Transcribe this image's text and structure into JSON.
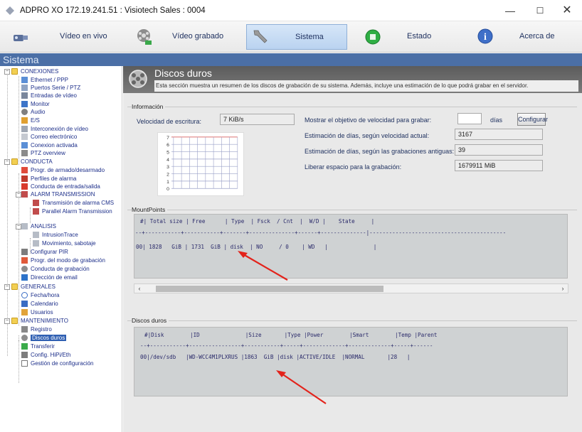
{
  "window": {
    "title": "ADPRO XO 172.19.241.51 : Visiotech Sales : 0004",
    "minimize": "—",
    "maximize": "☐",
    "close": "✕"
  },
  "toolbar": {
    "items": [
      {
        "label": "Vídeo en vivo",
        "icon": "camera-icon"
      },
      {
        "label": "Vídeo grabado",
        "icon": "film-reel-icon"
      },
      {
        "label": "Sistema",
        "icon": "wrench-icon",
        "active": true
      },
      {
        "label": "Estado",
        "icon": "status-icon"
      },
      {
        "label": "Acerca de",
        "icon": "info-icon"
      }
    ]
  },
  "sidebar": {
    "header": "Sistema",
    "items": [
      {
        "label": "CONEXIONES",
        "type": "folder"
      },
      {
        "label": "Ethernet / PPP"
      },
      {
        "label": "Puertos Serie / PTZ"
      },
      {
        "label": "Entradas de vídeo"
      },
      {
        "label": "Monitor"
      },
      {
        "label": "Audio"
      },
      {
        "label": "E/S"
      },
      {
        "label": "Interconexión de vídeo"
      },
      {
        "label": "Correo electrónico"
      },
      {
        "label": "Conexion activada"
      },
      {
        "label": "PTZ overview"
      },
      {
        "label": "CONDUCTA",
        "type": "folder"
      },
      {
        "label": "Progr. de armado/desarmado"
      },
      {
        "label": "Perfiles de alarma"
      },
      {
        "label": "Conducta de entrada/salida"
      },
      {
        "label": "ALARM TRANSMISSION"
      },
      {
        "label": "Transmisión de alarma CMS"
      },
      {
        "label": "Parallel Alarm Transmission"
      },
      {
        "label": "ANALISIS"
      },
      {
        "label": "IntrusionTrace"
      },
      {
        "label": "Movimiento, sabotaje"
      },
      {
        "label": "Configurar PIR"
      },
      {
        "label": "Progr. del modo de grabación"
      },
      {
        "label": "Conducta de grabación"
      },
      {
        "label": "Dirección de email"
      },
      {
        "label": "GENERALES",
        "type": "folder"
      },
      {
        "label": "Fecha/hora"
      },
      {
        "label": "Calendario"
      },
      {
        "label": "Usuarios"
      },
      {
        "label": "MANTENIMIENTO",
        "type": "folder"
      },
      {
        "label": "Registro"
      },
      {
        "label": "Discos duros",
        "selected": true
      },
      {
        "label": "Transferir"
      },
      {
        "label": "Config. HiPi/Eth"
      },
      {
        "label": "Gestión de configuración"
      }
    ]
  },
  "main": {
    "title": "Discos duros",
    "description": "Esta sección muestra un resumen de los discos de grabación de su sistema. Además, incluye una estimación de lo que podrá grabar en el servidor.",
    "informacion": {
      "group_label": "Información",
      "write_speed_label": "Velocidad de escritura:",
      "write_speed_value": "7 KiB/s",
      "chart_ticks": [
        "7",
        "6",
        "5",
        "4",
        "3",
        "2",
        "1",
        "0"
      ],
      "target_label": "Mostrar el objetivo de velocidad para grabar:",
      "target_value": "",
      "days_label": "días",
      "configure_button": "Configurar",
      "est_current_label": "Estimación de días, según velocidad actual:",
      "est_current_value": "3167",
      "est_old_label": "Estimación de días, según las grabaciones antiguas:",
      "est_old_value": "39",
      "free_label": "Liberar espacio para la grabación:",
      "free_value": "1679911 MiB"
    },
    "mountpoints": {
      "group_label": "MountPoints",
      "lines": [
        "#| Total size | Free      | Type  | Fsck  / Cnt  |  W/D |    State     |",
        "--+-----------+-----------+-------+--------------+------+--------------|------------------------------------------",
        "",
        "00| 1828   GiB | 1731  GiB | disk  | NO     / 0    | WD   |              |"
      ],
      "scroll_left": "‹",
      "scroll_right": "›"
    },
    "discos": {
      "group_label": "Discos duros",
      "lines": [
        "#|Disk        |ID              |Size       |Type |Power        |Smart        |Temp |Parent",
        "--+-----------+----------------+-----------+-----+-------------+-------------+-----+------",
        "",
        "00|/dev/sdb   |WD-WCC4M1PLXRUS |1863  GiB |disk |ACTIVE/IDLE  |NORMAL       |28   |"
      ]
    }
  },
  "colors": {
    "sistema_strip": "#4b6fa6",
    "header_bg": "#6a6a6a",
    "annotation_arrow": "#e3231b",
    "selected_item": "#2f5fb2"
  }
}
